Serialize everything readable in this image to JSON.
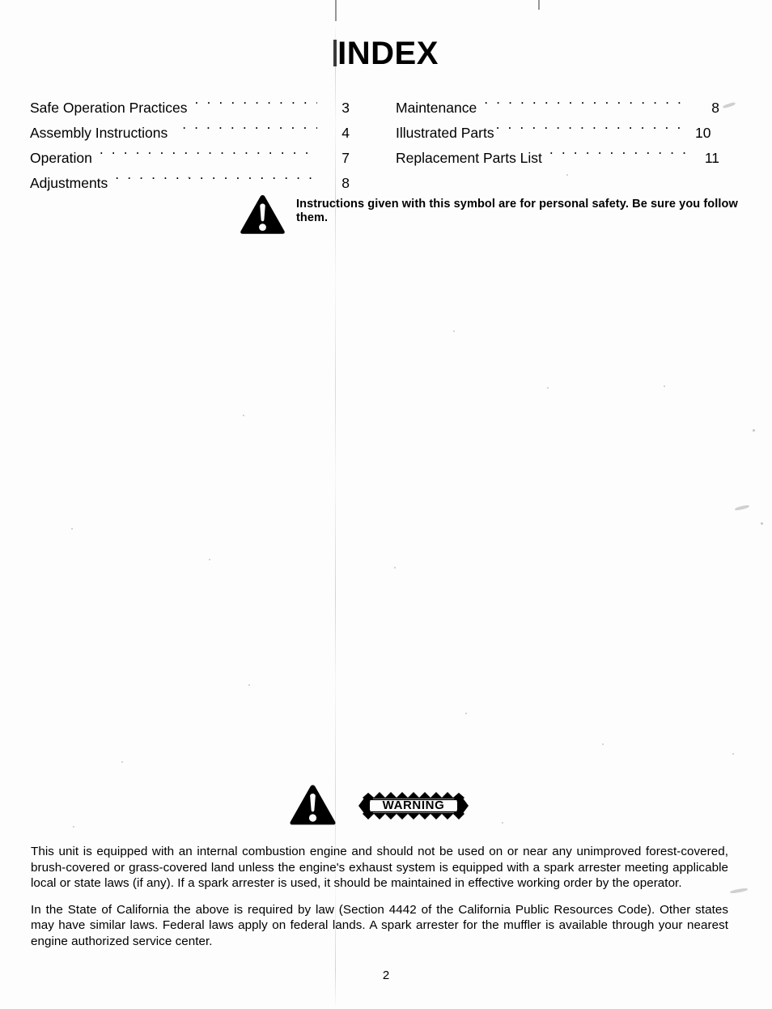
{
  "document": {
    "title": "INDEX",
    "page_number": "2"
  },
  "index": {
    "left_column": [
      {
        "label": "Safe Operation Practices",
        "page": "3"
      },
      {
        "label": "Assembly Instructions",
        "page": "4"
      },
      {
        "label": "Operation",
        "page": "7"
      },
      {
        "label": "Adjustments",
        "page": "8"
      }
    ],
    "right_column": [
      {
        "label": "Maintenance",
        "page": "8"
      },
      {
        "label": "Illustrated Parts",
        "page": "10"
      },
      {
        "label": "Replacement Parts List",
        "page": "11"
      }
    ]
  },
  "safety_note": {
    "icon": "warning-triangle-icon",
    "text": "Instructions given with this symbol are for personal safety. Be sure you follow them."
  },
  "warning_block": {
    "icon": "warning-triangle-icon",
    "banner_label": "WARNING",
    "paragraph_1": "This unit is equipped with an internal combustion engine and should not be used on or near any unimproved forest-covered, brush-covered or grass-covered land unless the engine's exhaust system is equipped with a spark arrester meeting applicable local or state laws (if any). If a spark arrester is used, it should be maintained in effective working order by the operator.",
    "paragraph_2": "In the State of California the above is required by law (Section 4442 of the California Public Resources Code). Other states may have similar laws. Federal laws apply on federal lands. A spark arrester for the muffler is available through your nearest engine authorized service center."
  },
  "colors": {
    "ink": "#000000",
    "paper": "#fdfdfd"
  }
}
